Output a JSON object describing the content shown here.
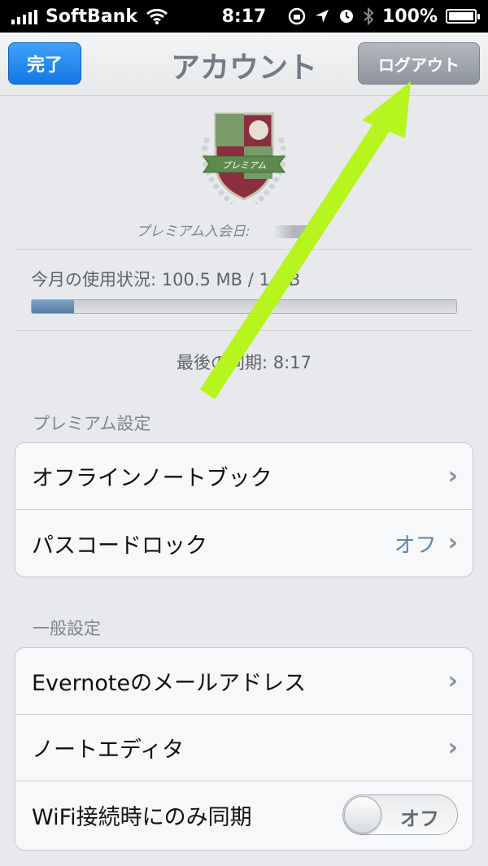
{
  "status_bar": {
    "carrier": "SoftBank",
    "time": "8:17",
    "battery": "100%",
    "icons": [
      "signal-icon",
      "wifi-icon",
      "rotation-lock-icon",
      "location-icon",
      "alarm-icon",
      "bluetooth-icon",
      "battery-icon"
    ]
  },
  "nav": {
    "title": "アカウント",
    "done_label": "完了",
    "logout_label": "ログアウト",
    "accent": "#1a7ee8"
  },
  "account": {
    "badge_text": "プレミアム",
    "premium_since_label": "プレミアム入会日:",
    "usage_label": "今月の使用状況: 100.5 MB / 1 GB",
    "usage_fraction": 0.1,
    "last_sync": "最後の同期: 8:17"
  },
  "premium_settings": {
    "header": "プレミアム設定",
    "items": [
      {
        "label": "オフラインノートブック",
        "value": ""
      },
      {
        "label": "パスコードロック",
        "value": "オフ"
      }
    ]
  },
  "general_settings": {
    "header": "一般設定",
    "items": [
      {
        "label": "Evernoteのメールアドレス"
      },
      {
        "label": "ノートエディタ"
      },
      {
        "label": "WiFi接続時にのみ同期",
        "toggle": "オフ"
      }
    ]
  },
  "annotation": {
    "arrow_color": "#b6f51e",
    "icon": "arrow-annotation-icon"
  }
}
